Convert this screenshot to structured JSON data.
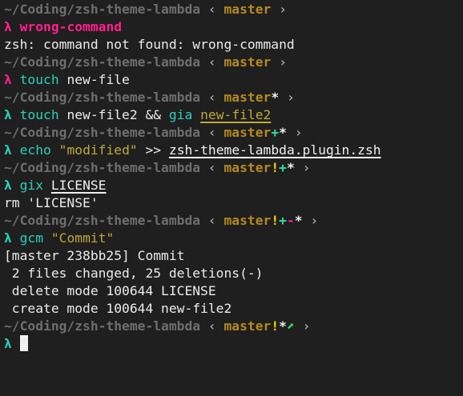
{
  "colors": {
    "background": "#1f1f1f",
    "text": "#ebebeb",
    "path": "#6e6e6e",
    "branch": "#b58a1e",
    "lambda_ok": "#2ad1b8",
    "lambda_err": "#ff1f8c",
    "command_ok": "#2ad1b8",
    "command_err": "#ff1f8c",
    "alias_expanded": "#2ad1b8",
    "string": "#bfa83a",
    "path_arg": "#f0f0f0",
    "staged_add": "#32e0a4",
    "staged_del": "#ff1f8c",
    "modified": "#f0f0f0",
    "stash": "#ffd400",
    "unpushed_arrow": "#32e064",
    "chevron": "#bdbdbd"
  },
  "terminal": {
    "lines": [
      {
        "type": "prompt",
        "path": "~/Coding/zsh-theme-lambda",
        "open": "‹",
        "branch": "master",
        "status": [],
        "close": "›"
      },
      {
        "type": "command",
        "lambda": "λ",
        "status": "err",
        "parts": [
          {
            "text": "wrong-command",
            "style": "cmd_err"
          }
        ]
      },
      {
        "type": "output",
        "text": "zsh: command not found: wrong-command"
      },
      {
        "type": "prompt",
        "path": "~/Coding/zsh-theme-lambda",
        "open": "‹",
        "branch": "master",
        "status": [],
        "close": "›"
      },
      {
        "type": "command",
        "lambda": "λ",
        "status": "err",
        "parts": [
          {
            "text": "touch",
            "style": "cmd_ok"
          },
          {
            "text": " new-file",
            "style": "plain"
          }
        ]
      },
      {
        "type": "prompt",
        "path": "~/Coding/zsh-theme-lambda",
        "open": "‹",
        "branch": "master",
        "status": [
          {
            "text": "*",
            "style": "modified"
          }
        ],
        "close": "›"
      },
      {
        "type": "command",
        "lambda": "λ",
        "status": "ok",
        "parts": [
          {
            "text": "touch",
            "style": "cmd_ok"
          },
          {
            "text": " new-file2 && ",
            "style": "plain"
          },
          {
            "text": "gia",
            "style": "cmd_ok"
          },
          {
            "text": " ",
            "style": "plain"
          },
          {
            "text": "new-file2",
            "style": "path_uline_yellow"
          }
        ]
      },
      {
        "type": "prompt",
        "path": "~/Coding/zsh-theme-lambda",
        "open": "‹",
        "branch": "master",
        "status": [
          {
            "text": "+",
            "style": "staged_add"
          },
          {
            "text": "*",
            "style": "modified"
          }
        ],
        "close": "›"
      },
      {
        "type": "command",
        "lambda": "λ",
        "status": "ok",
        "parts": [
          {
            "text": "echo",
            "style": "cmd_ok"
          },
          {
            "text": " ",
            "style": "plain"
          },
          {
            "text": "\"modified\"",
            "style": "string"
          },
          {
            "text": " >> ",
            "style": "plain"
          },
          {
            "text": "zsh-theme-lambda.plugin.zsh",
            "style": "path_uline"
          }
        ]
      },
      {
        "type": "prompt",
        "path": "~/Coding/zsh-theme-lambda",
        "open": "‹",
        "branch": "master",
        "status": [
          {
            "text": "!",
            "style": "stash"
          },
          {
            "text": "+",
            "style": "staged_add"
          },
          {
            "text": "*",
            "style": "modified"
          }
        ],
        "close": "›"
      },
      {
        "type": "command",
        "lambda": "λ",
        "status": "ok",
        "parts": [
          {
            "text": "gix",
            "style": "cmd_ok"
          },
          {
            "text": " ",
            "style": "plain"
          },
          {
            "text": "LICENSE",
            "style": "path_uline"
          }
        ]
      },
      {
        "type": "output",
        "text": "rm 'LICENSE'"
      },
      {
        "type": "prompt",
        "path": "~/Coding/zsh-theme-lambda",
        "open": "‹",
        "branch": "master",
        "status": [
          {
            "text": "!",
            "style": "stash"
          },
          {
            "text": "+",
            "style": "staged_add"
          },
          {
            "text": "-",
            "style": "staged_del"
          },
          {
            "text": "*",
            "style": "modified"
          }
        ],
        "close": "›"
      },
      {
        "type": "command",
        "lambda": "λ",
        "status": "ok",
        "parts": [
          {
            "text": "gcm",
            "style": "cmd_ok"
          },
          {
            "text": " ",
            "style": "plain"
          },
          {
            "text": "\"Commit\"",
            "style": "string"
          }
        ]
      },
      {
        "type": "output",
        "text": "[master 238bb25] Commit"
      },
      {
        "type": "output",
        "text": " 2 files changed, 25 deletions(-)"
      },
      {
        "type": "output",
        "text": " delete mode 100644 LICENSE"
      },
      {
        "type": "output",
        "text": " create mode 100644 new-file2"
      },
      {
        "type": "prompt",
        "path": "~/Coding/zsh-theme-lambda",
        "open": "‹",
        "branch": "master",
        "status": [
          {
            "text": "!",
            "style": "stash"
          },
          {
            "text": "*",
            "style": "modified"
          },
          {
            "text": "⬈",
            "style": "unpushed"
          }
        ],
        "close": "›"
      },
      {
        "type": "command",
        "lambda": "λ",
        "status": "ok",
        "parts": [],
        "cursor": true
      }
    ]
  }
}
